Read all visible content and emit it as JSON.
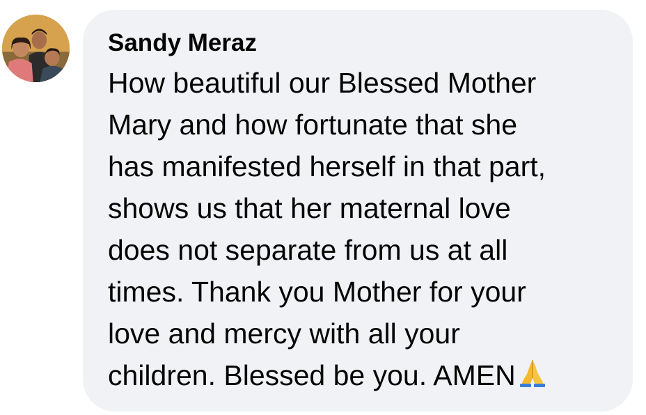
{
  "comment": {
    "author": "Sandy Meraz",
    "avatar_icon": "profile-photo-avatar",
    "lines": [
      "How beautiful our Blessed Mother",
      "Mary and how fortunate that she",
      "has manifested herself in that part,",
      "shows us that her maternal love",
      "does not separate from us at all",
      "times. Thank you Mother for your",
      "love and mercy with all your",
      "children. Blessed be you. AMEN"
    ],
    "emoji_icon": "folded-hands-icon",
    "colors": {
      "bubble": "#f0f2f5",
      "text": "#050505",
      "emoji": "#f5b82e"
    }
  }
}
